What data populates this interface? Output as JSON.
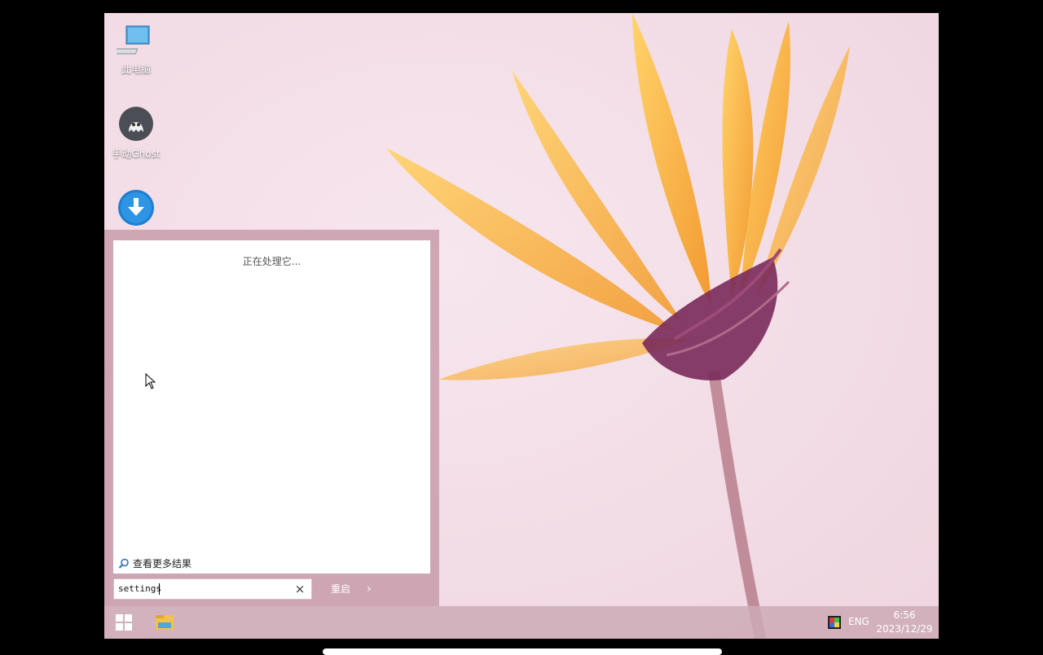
{
  "desktop": {
    "icons": [
      {
        "label": "此电脑",
        "icon": "computer-icon"
      },
      {
        "label": "手动Ghost",
        "icon": "ghost-icon"
      },
      {
        "label": "",
        "icon": "download-icon"
      }
    ]
  },
  "start_menu": {
    "status_text": "正在处理它...",
    "more_results_label": "查看更多结果",
    "search": {
      "value": "settings",
      "clear_label": "×"
    },
    "restart_label": "重启",
    "restart_arrow": "›"
  },
  "taskbar": {
    "language": "ENG",
    "time": "6:56",
    "date": "2023/12/29"
  },
  "colors": {
    "wallpaper_base": "#f4dbe6",
    "petal": "#f6a53c",
    "flower_center": "#7a2a5a",
    "menu_bg": "#c496a4"
  }
}
